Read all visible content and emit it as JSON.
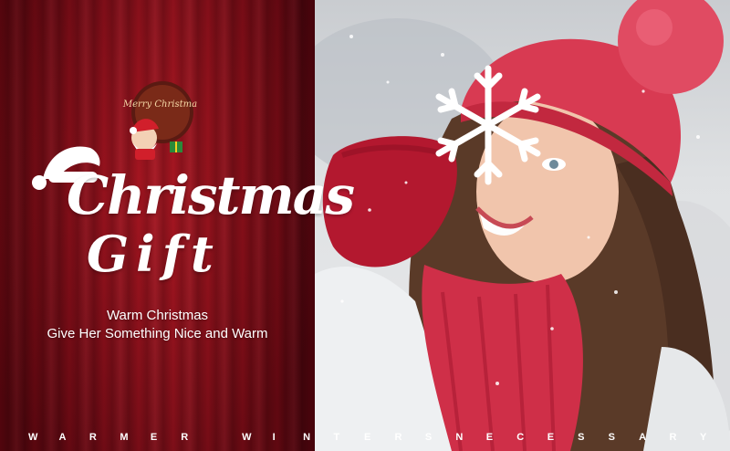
{
  "badge": {
    "text": "Merry Christmas"
  },
  "title": {
    "line1": "Christmas",
    "line2": "Gift"
  },
  "subtitle": {
    "line1": "Warm Christmas",
    "line2": "Give Her Something Nice and Warm"
  },
  "tagline": {
    "text": "WARMER WINTERSNECESSARY"
  },
  "colors": {
    "curtain": "#8d0d1a",
    "text": "#ffffff",
    "hat": "#e23a52"
  },
  "icons": [
    "santa-sack-icon",
    "santa-hat-icon",
    "snowflake-icon"
  ]
}
